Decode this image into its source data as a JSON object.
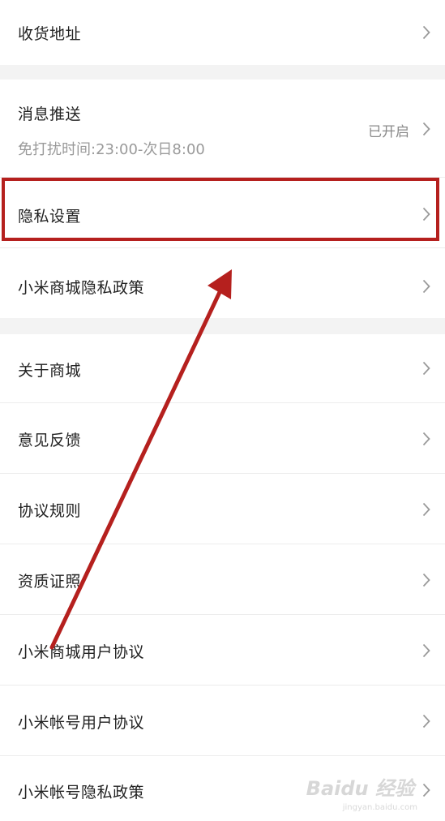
{
  "settings": {
    "address": "收货地址",
    "push": {
      "label": "消息推送",
      "subtitle": "免打扰时间:23:00-次日8:00",
      "status": "已开启"
    },
    "privacy_settings": "隐私设置",
    "mall_privacy_policy": "小米商城隐私政策",
    "about": "关于商城",
    "feedback": "意见反馈",
    "agreement_rules": "协议规则",
    "qualification": "资质证照",
    "mall_user_agreement": "小米商城用户协议",
    "account_user_agreement": "小米帐号用户协议",
    "account_privacy_policy": "小米帐号隐私政策"
  },
  "watermark": {
    "logo": "Baidu 经验",
    "url": "jingyan.baidu.com"
  },
  "colors": {
    "highlight": "#b5201e",
    "arrow": "#b5201e",
    "section_gap": "#f3f3f3"
  },
  "icons": {
    "chevron": "chevron-right-icon"
  }
}
